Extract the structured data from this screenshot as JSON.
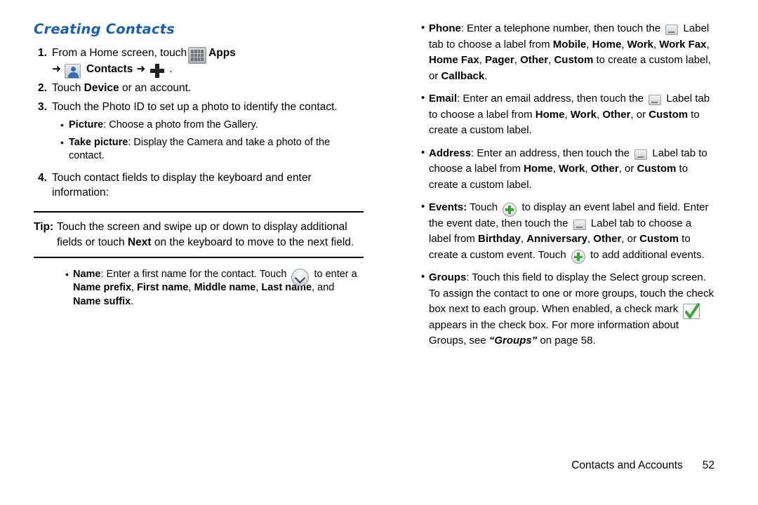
{
  "left": {
    "section_title": "Creating Contacts",
    "steps": [
      {
        "num": "1.",
        "text_before": "From a Home screen, touch",
        "apps_label": "Apps",
        "arrow": "➜",
        "contacts_label": "Contacts",
        "arrow2": "➜",
        "period": "."
      },
      {
        "num": "2.",
        "text_a": "Touch ",
        "bold_a": "Device",
        "text_b": " or an account."
      },
      {
        "num": "3.",
        "text": "Touch the Photo ID to set up a photo to identify the contact.",
        "sub_bullets": [
          {
            "bold": "Picture",
            "rest": ": Choose a photo from the Gallery."
          },
          {
            "bold": "Take picture",
            "rest": ": Display the Camera and take a photo of the contact."
          }
        ]
      },
      {
        "num": "4.",
        "text": "Touch contact fields to display the keyboard and enter information:"
      }
    ],
    "tip": {
      "label": "Tip:",
      "text_a": "Touch the screen and swipe up or down to display additional fields or touch ",
      "bold_a": "Next",
      "text_b": " on the keyboard to move to the next field."
    },
    "name_bullet": {
      "bold": "Name",
      "text_a": ": Enter a first name for the contact. Touch ",
      "text_b": " to enter a ",
      "b1": "Name prefix",
      "sep1": ", ",
      "b2": "First name",
      "sep2": ", ",
      "b3": "Middle name",
      "sep3": ", ",
      "b4": "Last name",
      "sep4": ", and ",
      "b5": "Name suffix",
      "end": "."
    }
  },
  "right": {
    "bullets": [
      {
        "id": "phone",
        "bold": "Phone",
        "t1": ": Enter a telephone number, then touch the ",
        "t2": " Label tab to choose a label from ",
        "opts": [
          "Mobile",
          "Home",
          "Work",
          "Work Fax",
          "Home Fax",
          "Pager",
          "Other",
          "Custom"
        ],
        "t3": " to create a custom label, or ",
        "bold_end": "Callback",
        "t4": "."
      },
      {
        "id": "email",
        "bold": "Email",
        "t1": ": Enter an email address, then touch the ",
        "t2": " Label tab to choose a label from ",
        "opts": [
          "Home",
          "Work",
          "Other"
        ],
        "t3": ", or ",
        "bold_end": "Custom",
        "t4": " to create a custom label."
      },
      {
        "id": "address",
        "bold": "Address",
        "t1": ": Enter an address, then touch the ",
        "t2": " Label tab to choose a label from ",
        "opts": [
          "Home",
          "Work",
          "Other"
        ],
        "t3": ", or ",
        "bold_end": "Custom",
        "t4": " to create a custom label."
      },
      {
        "id": "events",
        "bold": "Events:",
        "t1": " Touch ",
        "t2": " to display an event label and field. Enter the event date, then touch the ",
        "t3": " Label tab to choose a label from ",
        "opts": [
          "Birthday",
          "Anniversary",
          "Other"
        ],
        "t4": ", or ",
        "bold_end": "Custom",
        "t5": " to create a custom event. Touch ",
        "t6": " to add additional events."
      },
      {
        "id": "groups",
        "bold": "Groups",
        "t1": ": Touch this field to display the Select group screen. To assign the contact to one or more groups, touch the check box next to each group. When enabled, a check mark ",
        "t2": " appears in the check box. For more information about Groups, see ",
        "ref": "“Groups”",
        "t3": " on page 58."
      }
    ]
  },
  "footer": {
    "chapter": "Contacts and Accounts",
    "page": "52"
  }
}
